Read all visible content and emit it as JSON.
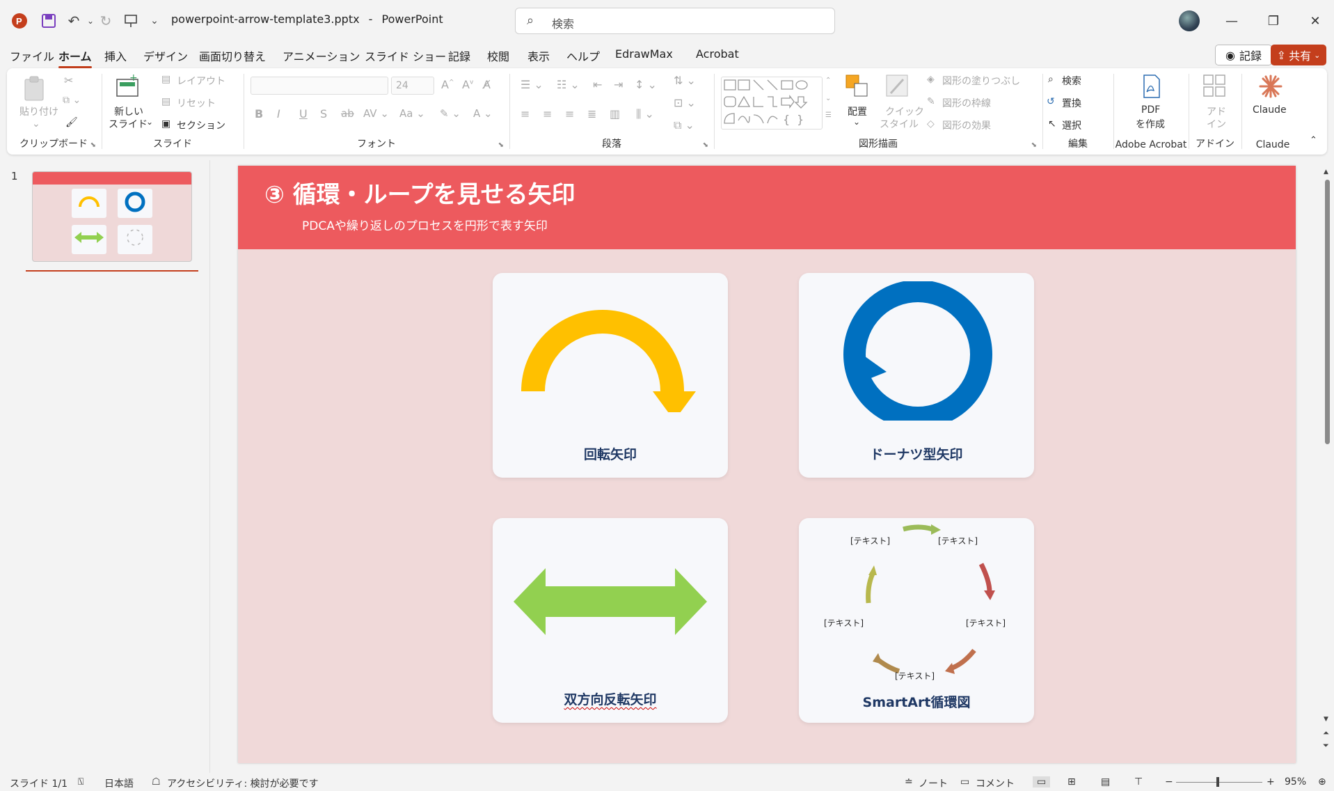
{
  "titlebar": {
    "filename": "powerpoint-arrow-template3.pptx",
    "separator": "-",
    "app_name": "PowerPoint",
    "search_placeholder": "検索"
  },
  "menu": {
    "tabs": [
      "ファイル",
      "ホーム",
      "挿入",
      "デザイン",
      "画面切り替え",
      "アニメーション",
      "スライド ショー",
      "記録",
      "校閲",
      "表示",
      "ヘルプ",
      "EdrawMax",
      "Acrobat"
    ],
    "active": "ホーム",
    "record_label": "記録",
    "share_label": "共有"
  },
  "ribbon": {
    "clipboard": {
      "paste": "貼り付け",
      "label": "クリップボード"
    },
    "slides": {
      "new_slide_1": "新しい",
      "new_slide_2": "スライド",
      "layout": "レイアウト",
      "reset": "リセット",
      "section": "セクション",
      "label": "スライド"
    },
    "font": {
      "size": "24",
      "label": "フォント"
    },
    "paragraph": {
      "label": "段落"
    },
    "drawing": {
      "arrange": "配置",
      "quick_style_1": "クイック",
      "quick_style_2": "スタイル",
      "fill": "図形の塗りつぶし",
      "outline": "図形の枠線",
      "effect": "図形の効果",
      "label": "図形描画"
    },
    "editing": {
      "find": "検索",
      "replace": "置換",
      "select": "選択",
      "label": "編集"
    },
    "acrobat": {
      "pdf_1": "PDF",
      "pdf_2": "を作成",
      "label": "Adobe Acrobat"
    },
    "addin": {
      "addin_1": "アド",
      "addin_2": "イン",
      "label": "アドイン"
    },
    "claude": {
      "name": "Claude",
      "label": "Claude"
    }
  },
  "thumbnails": {
    "number": "1"
  },
  "slide": {
    "title": "③ 循環・ループを見せる矢印",
    "subtitle": "PDCAや繰り返しのプロセスを円形で表す矢印",
    "cards": [
      {
        "label": "回転矢印"
      },
      {
        "label": "ドーナツ型矢印"
      },
      {
        "label": "双方向反転矢印"
      },
      {
        "label": "SmartArt循環図"
      }
    ],
    "smartart_text": "[テキスト]"
  },
  "statusbar": {
    "slide_info": "スライド 1/1",
    "language": "日本語",
    "accessibility": "アクセシビリティ: 検討が必要です",
    "notes": "ノート",
    "comments": "コメント",
    "zoom": "95%"
  },
  "colors": {
    "header_red": "#ed5a5e",
    "slide_bg": "#f0d9d9",
    "yellow_arrow": "#ffc000",
    "blue_donut": "#0070c0",
    "green_arrow": "#92d050",
    "accent": "#c43e1c"
  }
}
